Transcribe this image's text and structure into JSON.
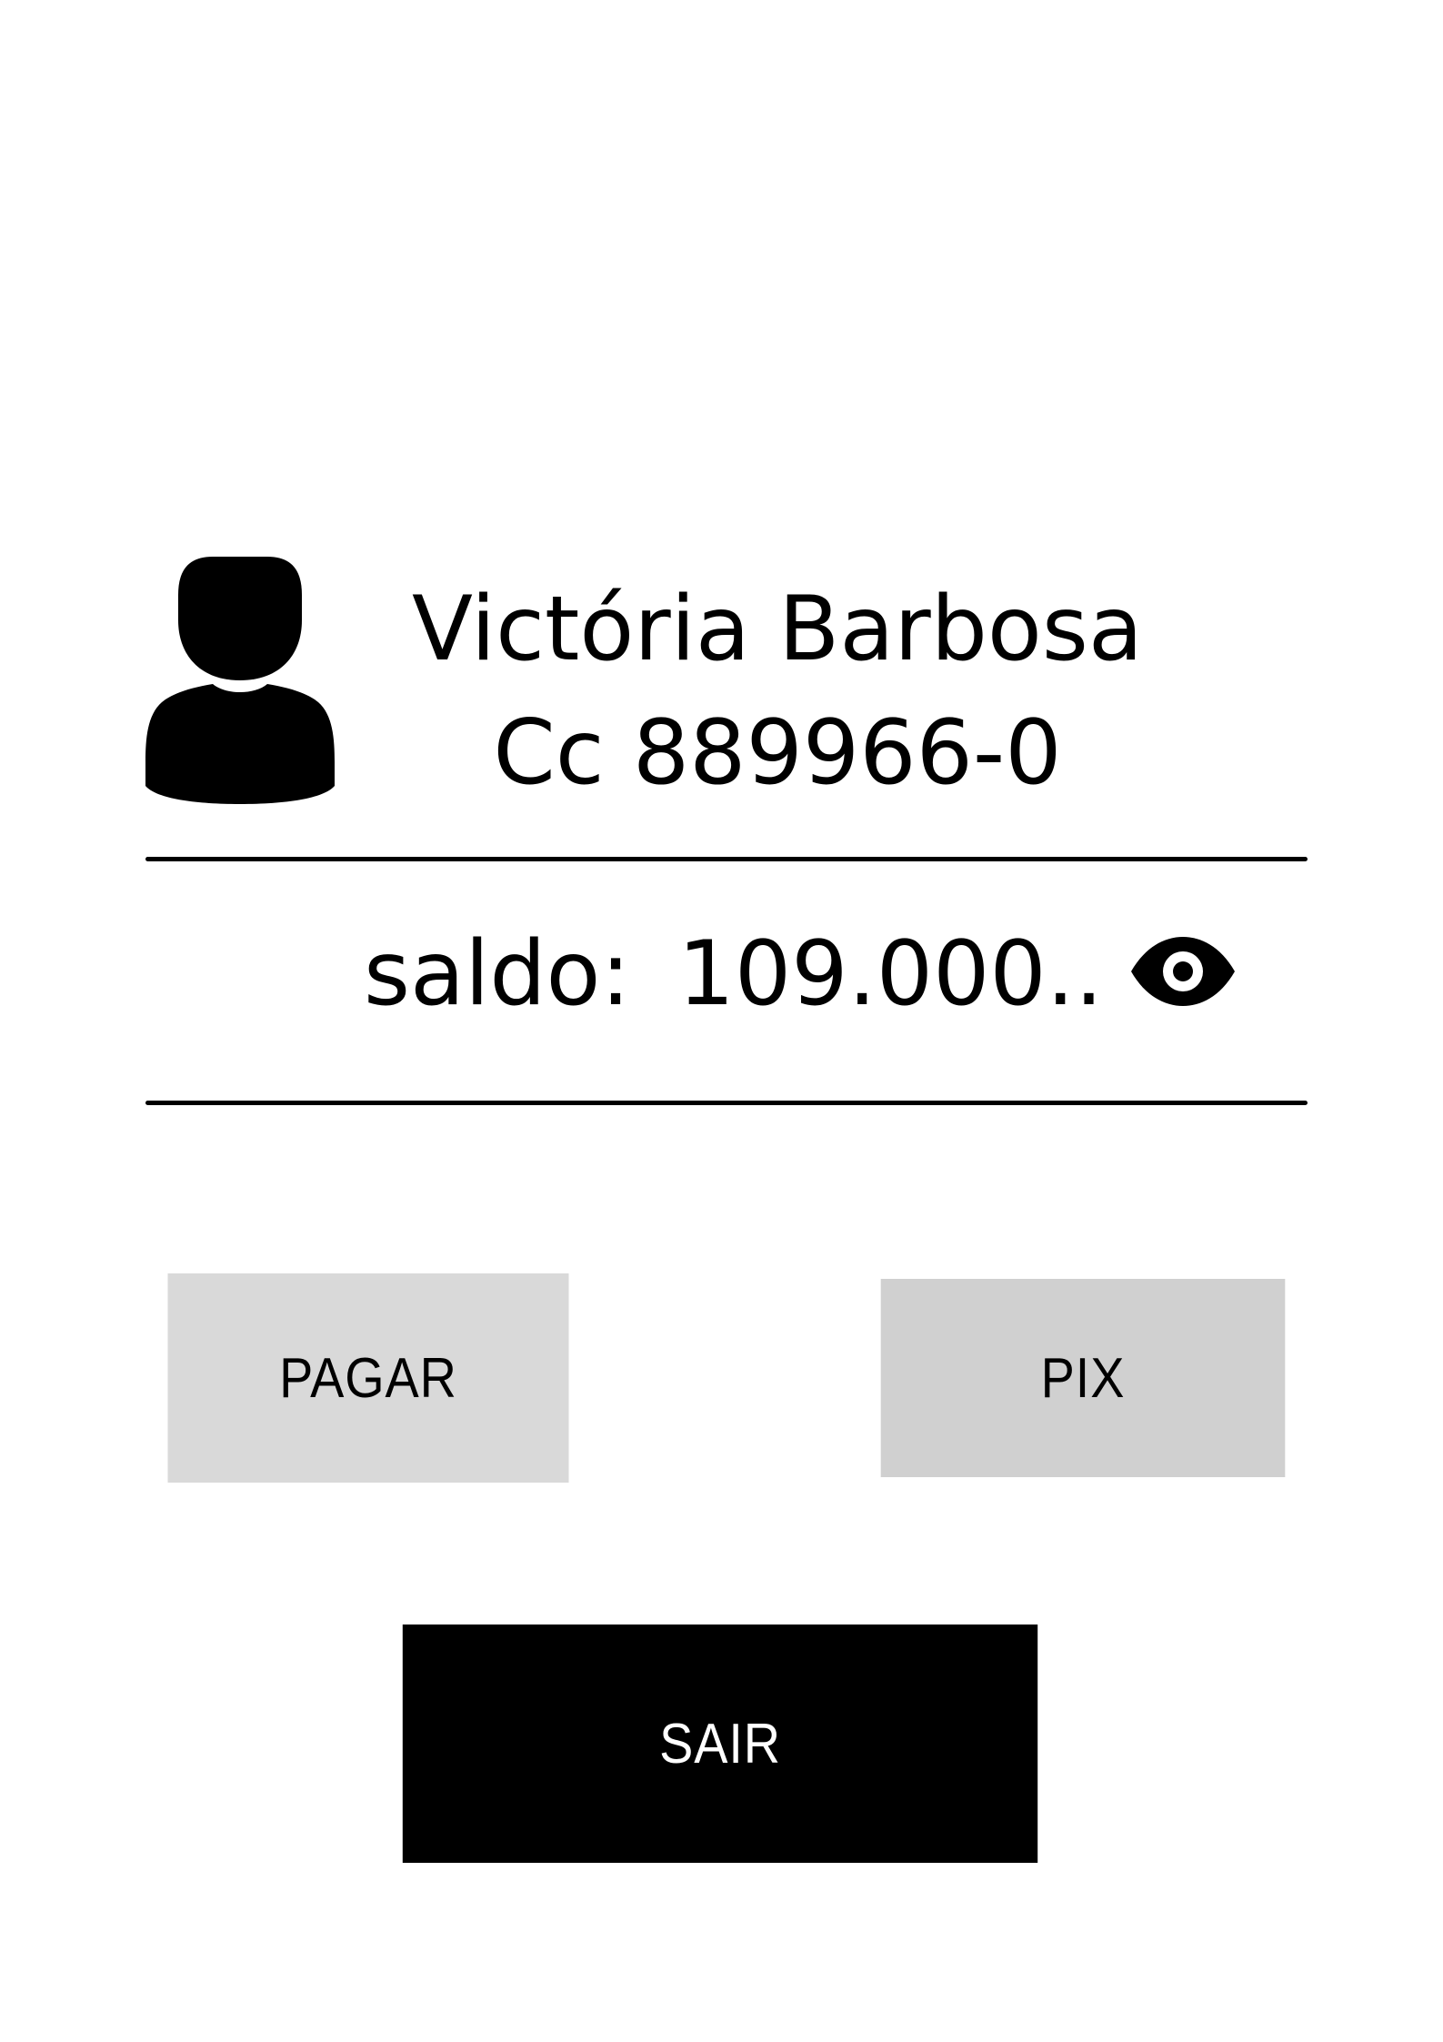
{
  "profile": {
    "avatar_icon": "user-silhouette-icon",
    "name": "Victória Barbosa",
    "account": "Cc 889966-0"
  },
  "balance": {
    "label": "saldo:",
    "value": "109.000..",
    "toggle_icon": "eye-icon"
  },
  "actions": {
    "pay_label": "PAGAR",
    "pix_label": "PIX",
    "exit_label": "SAIR"
  },
  "colors": {
    "background": "#ffffff",
    "text": "#000000",
    "pay_button": "#d9d9d9",
    "pix_button": "#d0d0d0",
    "exit_button": "#000000",
    "exit_text": "#ffffff"
  }
}
